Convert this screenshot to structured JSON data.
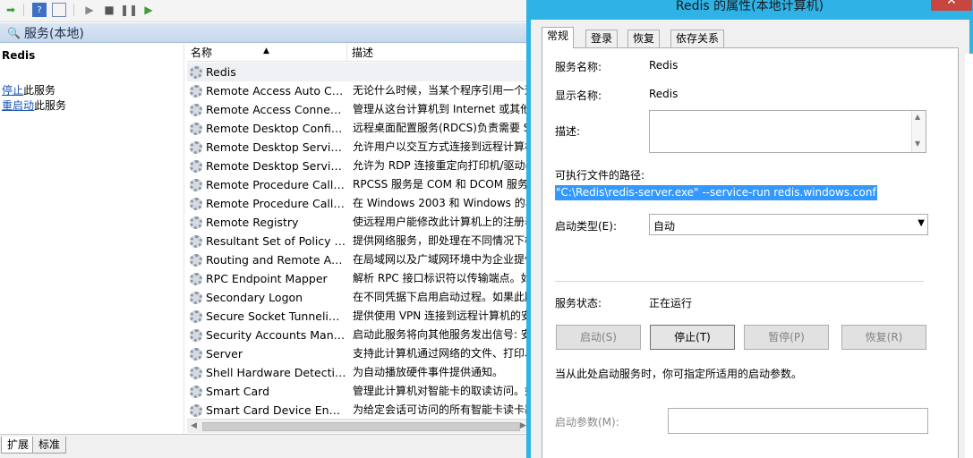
{
  "services_panel": {
    "header_title": "服务(本地)",
    "selected_service_name": "Redis",
    "actions": [
      {
        "link": "停止",
        "suffix": "此服务"
      },
      {
        "link": "重启动",
        "suffix": "此服务"
      }
    ],
    "columns": {
      "name": "名称",
      "description": "描述"
    },
    "rows": [
      {
        "name": "Redis",
        "description": ""
      },
      {
        "name": "Remote Access Auto Con...",
        "description": "无论什么时候，当某个程序引用一个远"
      },
      {
        "name": "Remote Access Connecti...",
        "description": "管理从这台计算机到 Internet 或其他"
      },
      {
        "name": "Remote Desktop Configu...",
        "description": "远程桌面配置服务(RDCS)负责需要 Sy"
      },
      {
        "name": "Remote Desktop Services",
        "description": "允许用户以交互方式连接到远程计算机"
      },
      {
        "name": "Remote Desktop Service...",
        "description": "允许为 RDP 连接重定向打印机/驱动器"
      },
      {
        "name": "Remote Procedure Call (...",
        "description": "RPCSS 服务是 COM 和 DCOM 服务器"
      },
      {
        "name": "Remote Procedure Call (...",
        "description": "在 Windows 2003 和 Windows 的早"
      },
      {
        "name": "Remote Registry",
        "description": "使远程用户能修改此计算机上的注册表"
      },
      {
        "name": "Resultant Set of Policy Pr...",
        "description": "提供网络服务，即处理在不同情况下模"
      },
      {
        "name": "Routing and Remote Acc...",
        "description": "在局域网以及广域网环境中为企业提供"
      },
      {
        "name": "RPC Endpoint Mapper",
        "description": "解析 RPC 接口标识符以传输端点。如"
      },
      {
        "name": "Secondary Logon",
        "description": "在不同凭据下启用启动过程。如果此服"
      },
      {
        "name": "Secure Socket Tunneling ...",
        "description": "提供使用 VPN 连接到远程计算机的安"
      },
      {
        "name": "Security Accounts Manag...",
        "description": "启动此服务将向其他服务发出信号: 安"
      },
      {
        "name": "Server",
        "description": "支持此计算机通过网络的文件、打印、和"
      },
      {
        "name": "Shell Hardware Detection",
        "description": "为自动播放硬件事件提供通知。"
      },
      {
        "name": "Smart Card",
        "description": "管理此计算机对智能卡的取读访问。如"
      },
      {
        "name": "Smart Card Device Enum...",
        "description": "为给定会话可访问的所有智能卡读卡器"
      }
    ],
    "bottom_tabs": [
      "扩展",
      "标准"
    ]
  },
  "dialog": {
    "title": "Redis 的属性(本地计算机)",
    "close_glyph": "✕",
    "tabs": [
      "常规",
      "登录",
      "恢复",
      "依存关系"
    ],
    "fields": {
      "service_name_label": "服务名称:",
      "service_name_value": "Redis",
      "display_name_label": "显示名称:",
      "display_name_value": "Redis",
      "description_label": "描述:",
      "path_label": "可执行文件的路径:",
      "path_value": "\"C:\\Redis\\redis-server.exe\" --service-run redis.windows.conf",
      "startup_type_label": "启动类型(E):",
      "startup_type_value": "自动",
      "status_label": "服务状态:",
      "status_value": "正在运行",
      "hint": "当从此处启动服务时，你可指定所适用的启动参数。",
      "param_label": "启动参数(M):"
    },
    "buttons": [
      {
        "label": "启动(S)",
        "enabled": false
      },
      {
        "label": "停止(T)",
        "enabled": true
      },
      {
        "label": "暂停(P)",
        "enabled": false
      },
      {
        "label": "恢复(R)",
        "enabled": false
      }
    ],
    "accent_color": "#2fb2e6",
    "selection_color": "#3399ff"
  }
}
